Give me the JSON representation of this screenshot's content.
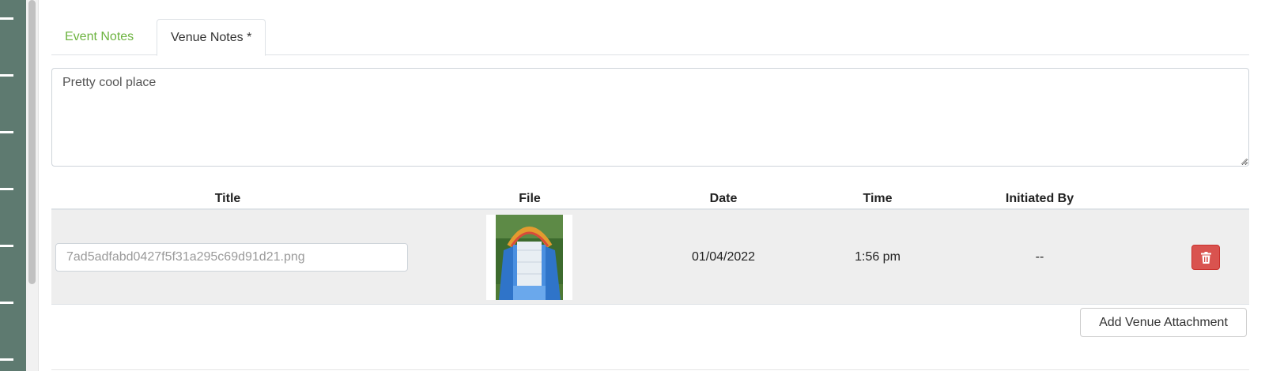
{
  "tabs": [
    {
      "label": "Event Notes",
      "active": false
    },
    {
      "label": "Venue Notes *",
      "active": true
    }
  ],
  "notes": {
    "value": "Pretty cool place"
  },
  "table": {
    "headers": [
      "Title",
      "File",
      "Date",
      "Time",
      "Initiated By"
    ],
    "rows": [
      {
        "title": "7ad5adfabd0427f5f31a295c69d91d21.png",
        "file_icon": "inflatable-slide-image",
        "date": "01/04/2022",
        "time": "1:56 pm",
        "initiated_by": "--",
        "action_icon": "trash-icon"
      }
    ]
  },
  "actions": {
    "add_label": "Add Venue Attachment"
  },
  "colors": {
    "accent_green": "#6cb33f",
    "rail": "#5e7a70",
    "danger": "#d9534f"
  }
}
